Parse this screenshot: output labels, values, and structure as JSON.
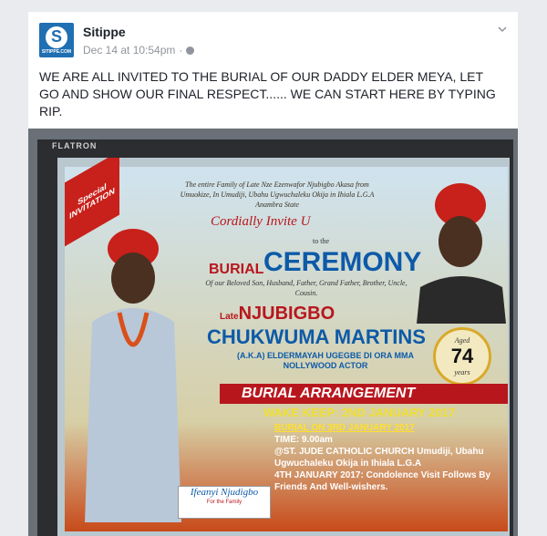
{
  "post": {
    "author": "Sitippe",
    "avatar_url_text": "SITIPPE.COM",
    "timestamp": "Dec 14 at 10:54pm",
    "separator": "·",
    "message": "WE ARE ALL INVITED TO THE BURIAL OF OUR DADDY ELDER MEYA, LET GO AND SHOW OUR FINAL RESPECT...... WE CAN START HERE BY TYPING RIP."
  },
  "photo": {
    "monitor_brand": "FLATRON",
    "poster": {
      "ribbon": "Special INVITATION",
      "family_line": "The entire Family of Late Nze Ezenwafor Njubigbo Akasa from Umuokize, In Umudiji, Ubahu Ugwuchaleku Okija in Ihiala L.G.A Anambra State",
      "invite": "Cordially Invite U",
      "to_the": "to the",
      "burial": "BURIAL",
      "ceremony": "CEREMONY",
      "beloved": "Of our Beloved Son, Husband, Father, Grand Father, Brother, Uncle, Cousin.",
      "late_prefix": "Late",
      "late_name": "NJUBIGBO",
      "full_name": "CHUKWUMA MARTINS",
      "aka": "(A.K.A) ELDERMAYAH UGEGBE DI ORA MMA NOLLYWOOD ACTOR",
      "age_label": "Aged",
      "age": "74",
      "age_unit": "years",
      "arrangement": "BURIAL ARRANGEMENT",
      "wake_keep": "WAKE KEEP: 2ND JANUARY 2017",
      "burial_date": "BURIAL ON 3RD JANUARY 2017",
      "time": "TIME: 9.00am",
      "venue": "@ST. JUDE CATHOLIC CHURCH Umudiji, Ubahu Ugwuchaleku Okija in Ihiala L.G.A",
      "condolence": "4TH JANUARY 2017: Condolence Visit Follows By Friends And Well-wishers.",
      "signer": "Ifeanyi Njudigbo",
      "signer_sub": "For the Family"
    }
  }
}
